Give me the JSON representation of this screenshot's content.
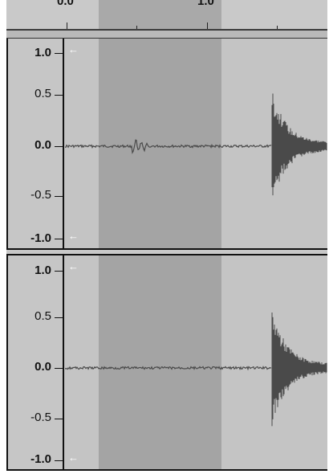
{
  "timeline": {
    "labels": [
      "0.0",
      "1.0"
    ]
  },
  "channels": [
    {
      "name": "channel-1",
      "scale_labels": [
        "1.0",
        "0.5",
        "0.0",
        "-0.5",
        "-1.0"
      ]
    },
    {
      "name": "channel-2",
      "scale_labels": [
        "1.0",
        "0.5",
        "0.0",
        "-0.5",
        "-1.0"
      ]
    }
  ],
  "colors": {
    "waveform": "#4a4a4a",
    "selection": "#a4a4a4",
    "background": "#c4c4c4"
  },
  "icons": {
    "clip_arrow": "←"
  }
}
